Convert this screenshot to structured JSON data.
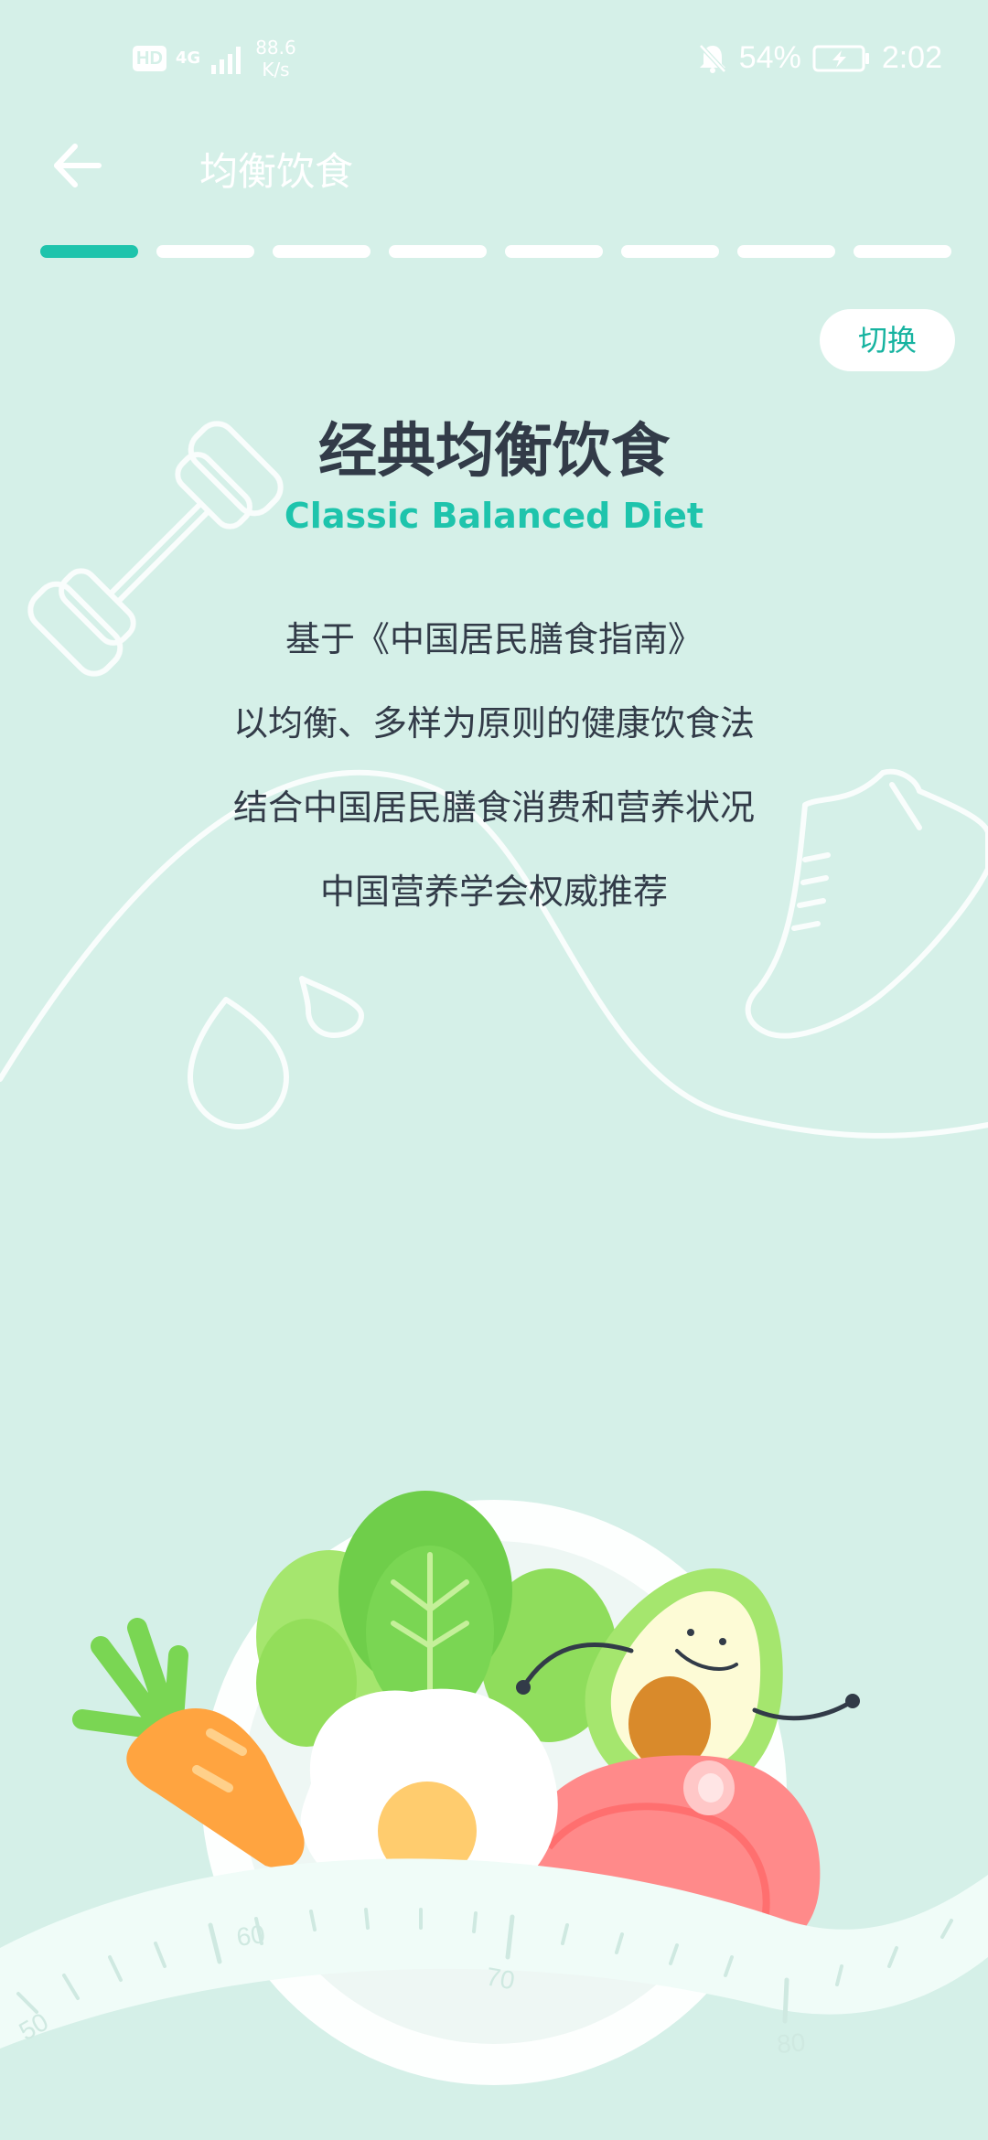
{
  "status_bar": {
    "hd_label": "HD",
    "network_label": "4G",
    "speed_value": "88.6",
    "speed_unit": "K/s",
    "battery_percent": "54%",
    "time": "2:02"
  },
  "header": {
    "title": "均衡饮食"
  },
  "progress": {
    "total_steps": 8,
    "current_step": 1
  },
  "switch_label": "切换",
  "content": {
    "heading": "经典均衡饮食",
    "subheading": "Classic Balanced Diet",
    "lines": [
      "基于《中国居民膳食指南》",
      "以均衡、多样为原则的健康饮食法",
      "结合中国居民膳食消费和营养状况",
      "中国营养学会权威推荐"
    ]
  },
  "illustration": {
    "tape_labels": [
      "50",
      "60",
      "70",
      "80"
    ]
  },
  "colors": {
    "background": "#d5f0e8",
    "accent": "#1ec4ac",
    "text_dark": "#323b48"
  }
}
